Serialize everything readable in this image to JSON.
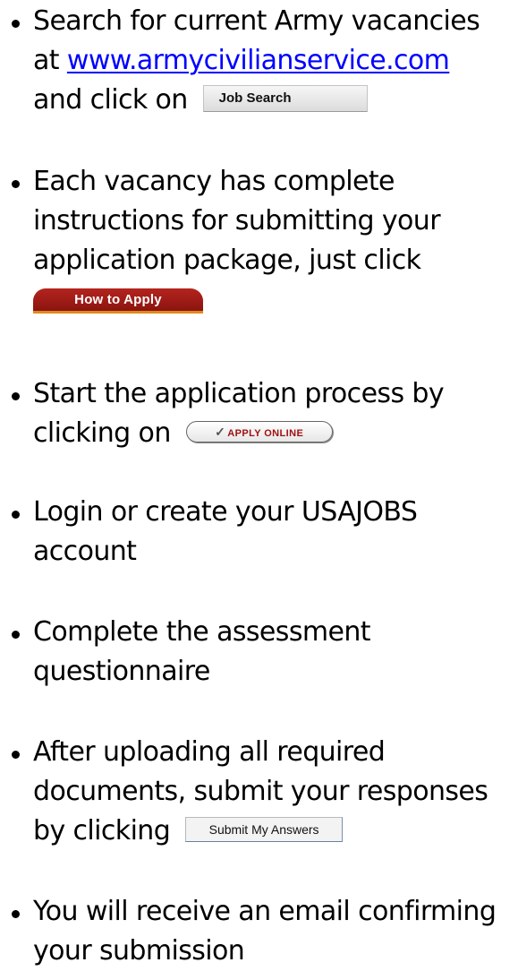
{
  "steps": [
    {
      "lines": [
        "Search for current Army vacancies",
        "at ",
        "and click on "
      ],
      "link": "www.armycivilianservice.com",
      "button_label": "Job Search"
    },
    {
      "lines": [
        "Each vacancy has complete",
        "instructions for submitting your",
        "application package, just click"
      ],
      "button_label": "How to Apply"
    },
    {
      "lines": [
        "Start the application process by",
        "clicking on "
      ],
      "button_label": "APPLY ONLINE"
    },
    {
      "lines": [
        "Login or create your USAJOBS",
        "account"
      ]
    },
    {
      "lines": [
        "Complete the assessment",
        "questionnaire"
      ]
    },
    {
      "lines": [
        "After uploading all required",
        "documents, submit your responses",
        "by clicking "
      ],
      "button_label": "Submit My Answers"
    },
    {
      "lines": [
        "You will receive an email confirming",
        "your submission"
      ]
    }
  ]
}
